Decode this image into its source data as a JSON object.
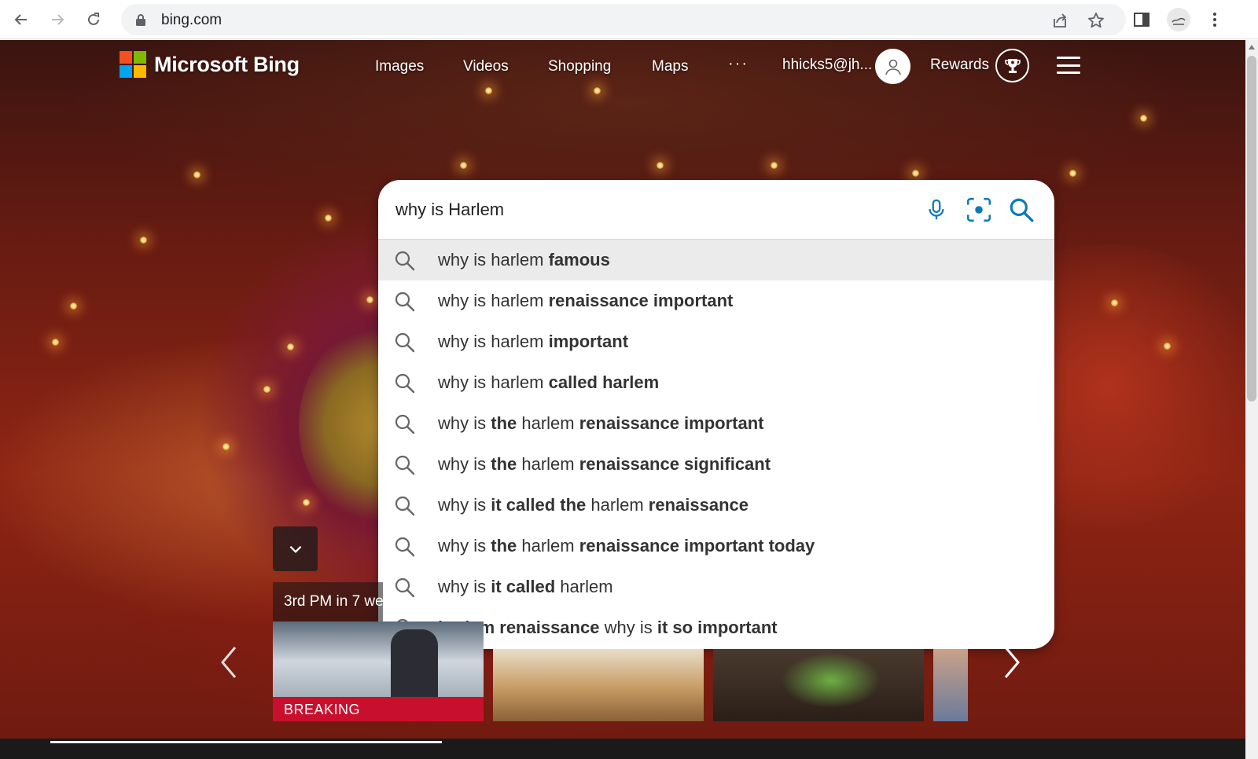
{
  "browser": {
    "url": "bing.com"
  },
  "header": {
    "brand": "Microsoft Bing",
    "nav": [
      "Images",
      "Videos",
      "Shopping",
      "Maps"
    ],
    "more": "···",
    "account": "hhicks5@jh...",
    "rewards": "Rewards"
  },
  "search": {
    "query": "why is Harlem",
    "suggestions": [
      [
        {
          "t": "why is harlem ",
          "b": false
        },
        {
          "t": "famous",
          "b": true
        }
      ],
      [
        {
          "t": "why is harlem ",
          "b": false
        },
        {
          "t": "renaissance important",
          "b": true
        }
      ],
      [
        {
          "t": "why is harlem ",
          "b": false
        },
        {
          "t": "important",
          "b": true
        }
      ],
      [
        {
          "t": "why is harlem ",
          "b": false
        },
        {
          "t": "called harlem",
          "b": true
        }
      ],
      [
        {
          "t": "why is ",
          "b": false
        },
        {
          "t": "the",
          "b": true
        },
        {
          "t": " harlem ",
          "b": false
        },
        {
          "t": "renaissance important",
          "b": true
        }
      ],
      [
        {
          "t": "why is ",
          "b": false
        },
        {
          "t": "the",
          "b": true
        },
        {
          "t": " harlem ",
          "b": false
        },
        {
          "t": "renaissance significant",
          "b": true
        }
      ],
      [
        {
          "t": "why is ",
          "b": false
        },
        {
          "t": "it called the",
          "b": true
        },
        {
          "t": " harlem ",
          "b": false
        },
        {
          "t": "renaissance",
          "b": true
        }
      ],
      [
        {
          "t": "why is ",
          "b": false
        },
        {
          "t": "the",
          "b": true
        },
        {
          "t": " harlem ",
          "b": false
        },
        {
          "t": "renaissance important today",
          "b": true
        }
      ],
      [
        {
          "t": "why is ",
          "b": false
        },
        {
          "t": "it called",
          "b": true
        },
        {
          "t": " harlem",
          "b": false
        }
      ],
      [
        {
          "t": "harlem renaissance",
          "b": true
        },
        {
          "t": " why is ",
          "b": false
        },
        {
          "t": "it so important",
          "b": true
        }
      ]
    ],
    "highlighted_index": 0
  },
  "carousel": {
    "title": "3rd PM in 7 we",
    "badge": "BREAKING"
  },
  "colors": {
    "ms_red": "#f25022",
    "ms_green": "#7fba00",
    "ms_blue": "#00a4ef",
    "ms_yellow": "#ffb900",
    "bing_teal": "#0c7ab8"
  },
  "icons": [
    "back-arrow-icon",
    "forward-arrow-icon",
    "reload-icon",
    "lock-icon",
    "share-icon",
    "star-icon",
    "side-panel-icon",
    "profile-icon",
    "kebab-menu-icon",
    "user-icon",
    "trophy-icon",
    "hamburger-icon",
    "microphone-icon",
    "visual-search-icon",
    "search-icon",
    "chevron-down-icon",
    "chevron-left-icon",
    "chevron-right-icon"
  ]
}
